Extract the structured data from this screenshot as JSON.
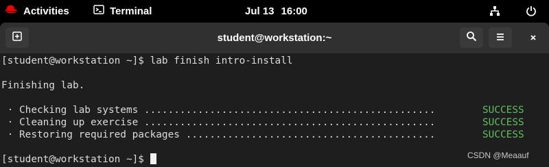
{
  "topbar": {
    "activities_label": "Activities",
    "app_label": "Terminal",
    "date": "Jul 13",
    "time": "16:00"
  },
  "window": {
    "title": "student@workstation:~"
  },
  "terminal": {
    "command_prompt": "[student@workstation ~]$ ",
    "command": "lab finish intro-install",
    "blank1": "",
    "finishing": "Finishing lab.",
    "blank2": "",
    "steps": [
      {
        "text": " · Checking lab systems .................................................",
        "status": "SUCCESS"
      },
      {
        "text": " · Cleaning up exercise .................................................",
        "status": "SUCCESS"
      },
      {
        "text": " · Restoring required packages ..........................................",
        "status": "SUCCESS"
      }
    ],
    "final_prompt": "[student@workstation ~]$"
  },
  "watermark": "CSDN @Meaauf",
  "colors": {
    "success": "#5fbf60",
    "background": "#1e1e1e",
    "headerbar": "#303030",
    "redhat_red": "#ee0000"
  }
}
